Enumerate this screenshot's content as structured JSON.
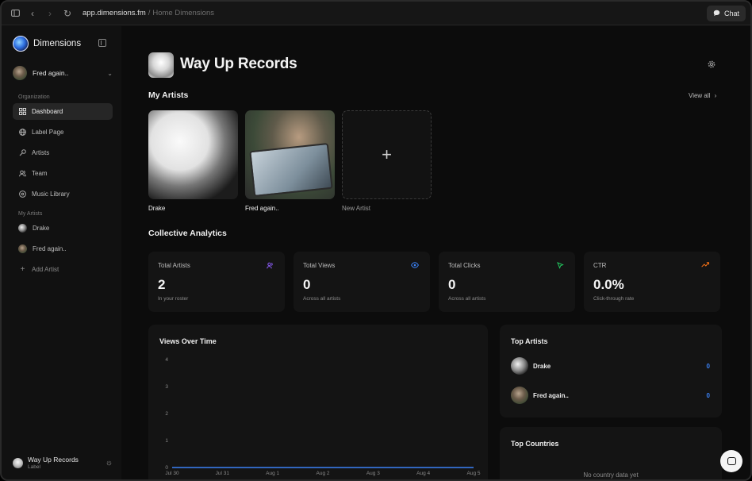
{
  "browser": {
    "url": "app.dimensions.fm",
    "breadcrumb": "Home Dimensions",
    "separator": "/",
    "chat_label": "Chat"
  },
  "sidebar": {
    "brand": "Dimensions",
    "account": "Fred again..",
    "org_label": "Organization",
    "nav": [
      {
        "label": "Dashboard",
        "icon": "dashboard-icon",
        "active": true
      },
      {
        "label": "Label Page",
        "icon": "globe-icon"
      },
      {
        "label": "Artists",
        "icon": "mic-icon"
      },
      {
        "label": "Team",
        "icon": "users-icon"
      },
      {
        "label": "Music Library",
        "icon": "disc-icon"
      }
    ],
    "my_artists_label": "My Artists",
    "artists": [
      "Drake",
      "Fred again.."
    ],
    "add_artist": "Add Artist",
    "footer": {
      "name": "Way Up Records",
      "role": "Label"
    }
  },
  "main": {
    "title": "Way Up Records",
    "my_artists_heading": "My Artists",
    "view_all": "View all",
    "artist_cards": [
      "Drake",
      "Fred again..",
      "New Artist"
    ],
    "analytics_heading": "Collective Analytics",
    "stats": [
      {
        "title": "Total Artists",
        "value": "2",
        "sub": "In your roster",
        "icon": "users-icon",
        "color": "#8b5cf6"
      },
      {
        "title": "Total Views",
        "value": "0",
        "sub": "Across all artists",
        "icon": "eye-icon",
        "color": "#3b82f6"
      },
      {
        "title": "Total Clicks",
        "value": "0",
        "sub": "Across all artists",
        "icon": "pointer-icon",
        "color": "#22c55e"
      },
      {
        "title": "CTR",
        "value": "0.0%",
        "sub": "Click-through rate",
        "icon": "trend-icon",
        "color": "#f97316"
      }
    ],
    "top_artists": {
      "title": "Top Artists",
      "rows": [
        {
          "name": "Drake",
          "value": "0"
        },
        {
          "name": "Fred again..",
          "value": "0"
        }
      ]
    },
    "top_countries": {
      "title": "Top Countries",
      "empty": "No country data yet"
    }
  },
  "chart_data": {
    "type": "line",
    "title": "Views Over Time",
    "categories": [
      "Jul 30",
      "Jul 31",
      "Aug 1",
      "Aug 2",
      "Aug 3",
      "Aug 4",
      "Aug 5"
    ],
    "series": [
      {
        "values": [
          0,
          0,
          0,
          0,
          0,
          0,
          0
        ],
        "color": "#3b82f6"
      }
    ],
    "yticks": [
      0,
      1,
      2,
      3,
      4
    ],
    "ylim": [
      0,
      4
    ],
    "grid": false
  }
}
